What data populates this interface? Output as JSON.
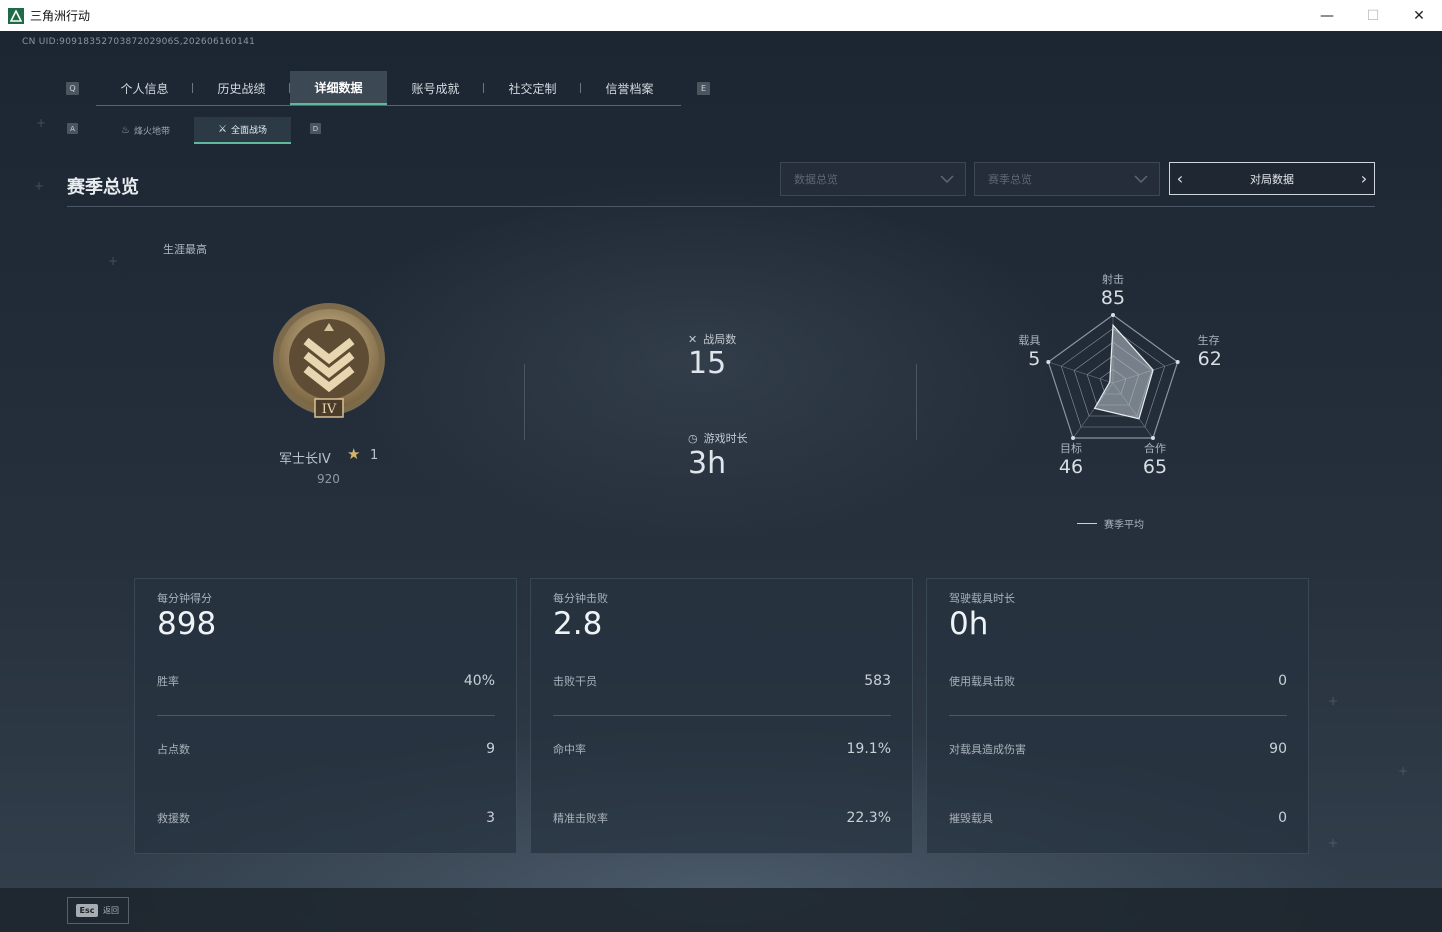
{
  "window": {
    "title": "三角洲行动",
    "controls": [
      "minimize",
      "maximize",
      "close"
    ]
  },
  "header": {
    "uid": "CN UID:9091835270387202906S,202606160141",
    "main_tabs": [
      {
        "label": "个人信息",
        "active": false
      },
      {
        "label": "历史战绩",
        "active": false
      },
      {
        "label": "详细数据",
        "active": true
      },
      {
        "label": "账号成就",
        "active": false
      },
      {
        "label": "社交定制",
        "active": false
      },
      {
        "label": "信誉档案",
        "active": false
      }
    ],
    "main_keys": {
      "left": "Q",
      "right": "E"
    },
    "sub_tabs": [
      {
        "label": "烽火地带",
        "active": false
      },
      {
        "label": "全面战场",
        "active": true
      }
    ],
    "sub_keys": {
      "left": "A",
      "right": "D"
    }
  },
  "section": {
    "title": "赛季总览",
    "dropdown1": "数据总览",
    "dropdown2": "赛季总览",
    "match_data": "对局数据"
  },
  "overview": {
    "career_label": "生涯最高",
    "rank_name": "军士长IV",
    "rank_stars": "1",
    "rank_points": "920",
    "badge_numeral": "IV",
    "matches_label": "战局数",
    "matches_value": "15",
    "playtime_label": "游戏时长",
    "playtime_value": "3h"
  },
  "radar": {
    "legend": "赛季平均",
    "axes": [
      {
        "label": "射击",
        "value": "85"
      },
      {
        "label": "生存",
        "value": "62"
      },
      {
        "label": "合作",
        "value": "65"
      },
      {
        "label": "目标",
        "value": "46"
      },
      {
        "label": "载具",
        "value": "5"
      }
    ]
  },
  "cards": [
    {
      "header_label": "每分钟得分",
      "header_value": "898",
      "rows": [
        {
          "label": "胜率",
          "value": "40%"
        },
        {
          "label": "占点数",
          "value": "9"
        },
        {
          "label": "救援数",
          "value": "3"
        }
      ]
    },
    {
      "header_label": "每分钟击败",
      "header_value": "2.8",
      "rows": [
        {
          "label": "击败干员",
          "value": "583"
        },
        {
          "label": "命中率",
          "value": "19.1%"
        },
        {
          "label": "精准击败率",
          "value": "22.3%"
        }
      ]
    },
    {
      "header_label": "驾驶载具时长",
      "header_value": "0h",
      "rows": [
        {
          "label": "使用载具击败",
          "value": "0"
        },
        {
          "label": "对载具造成伤害",
          "value": "90"
        },
        {
          "label": "摧毁载具",
          "value": "0"
        }
      ]
    }
  ],
  "footer": {
    "esc_key": "Esc",
    "esc_label": "返回"
  }
}
